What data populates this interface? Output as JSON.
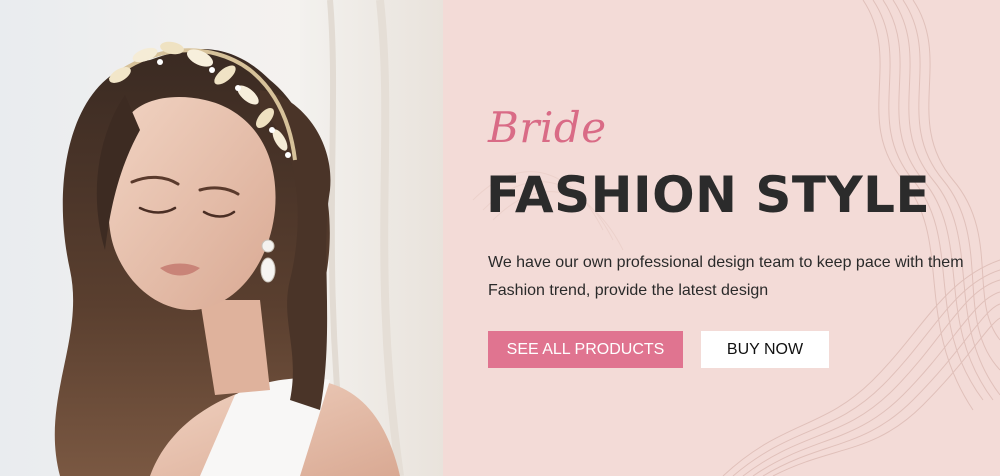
{
  "hero": {
    "script_title": "Bride",
    "main_title": "FASHION STYLE",
    "description_line1": "We have our own professional design team to keep pace with them",
    "description_line2": "Fashion trend, provide the latest design"
  },
  "buttons": {
    "primary_label": "SEE ALL PRODUCTS",
    "secondary_label": "BUY NOW"
  },
  "colors": {
    "panel_background": "#f3dbd7",
    "accent_pink": "#e07490",
    "script_pink": "#d96b86",
    "title_dark": "#2b2b2b"
  },
  "icons": {
    "photo": "bride-portrait-with-floral-headband",
    "background_decoration": "wavy-line-pattern"
  }
}
